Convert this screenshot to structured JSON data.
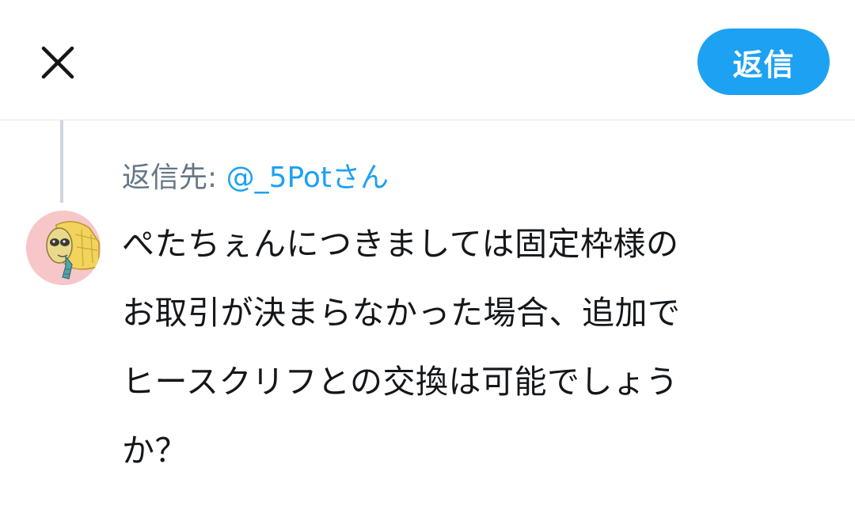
{
  "header": {
    "close_icon": "close-icon",
    "reply_button_label": "返信"
  },
  "compose": {
    "reply_to_prefix": "返信先: ",
    "reply_to_handle": "@_5Potさん",
    "avatar_icon": "user-avatar",
    "text_lines": [
      "ぺたちぇんにつきましては固定枠様の",
      "お取引が決まらなかった場合、追加で",
      "ヒースクリフとの交換は可能でしょう",
      "か？"
    ]
  },
  "colors": {
    "accent": "#1da1f2",
    "secondary_text": "#657786",
    "primary_text": "#14171a",
    "divider": "#e1e8ed",
    "thread_line": "#ccd6dd"
  }
}
